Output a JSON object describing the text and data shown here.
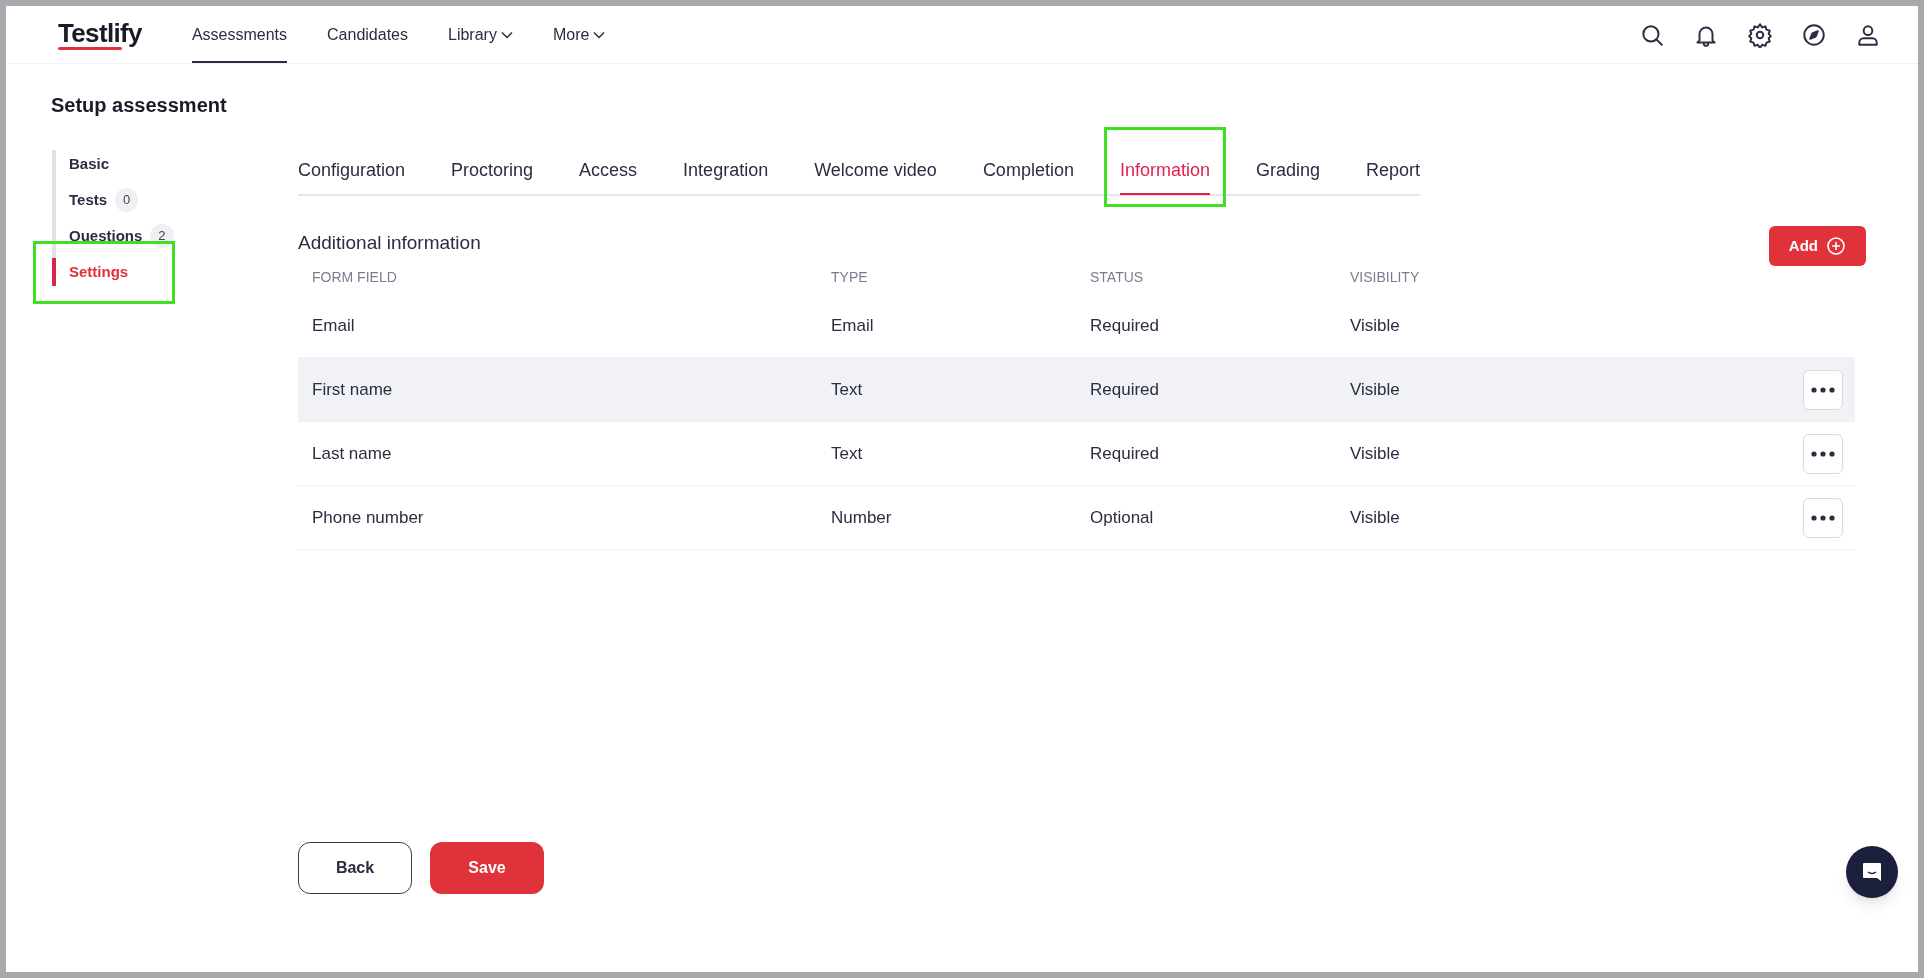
{
  "logo": "Testlify",
  "nav": [
    {
      "label": "Assessments",
      "selected": true,
      "dropdown": false
    },
    {
      "label": "Candidates",
      "selected": false,
      "dropdown": false
    },
    {
      "label": "Library",
      "selected": false,
      "dropdown": true
    },
    {
      "label": "More",
      "selected": false,
      "dropdown": true
    }
  ],
  "page_title": "Setup assessment",
  "sidebar": {
    "items": [
      {
        "label": "Basic",
        "selected": false,
        "highlighted": false
      },
      {
        "label": "Tests",
        "count": "0",
        "selected": false,
        "highlighted": false
      },
      {
        "label": "Questions",
        "count": "2",
        "selected": false,
        "highlighted": false
      },
      {
        "label": "Settings",
        "selected": true,
        "highlighted": true
      }
    ]
  },
  "tabs": [
    {
      "label": "Configuration",
      "selected": false,
      "highlighted": false
    },
    {
      "label": "Proctoring",
      "selected": false,
      "highlighted": false
    },
    {
      "label": "Access",
      "selected": false,
      "highlighted": false
    },
    {
      "label": "Integration",
      "selected": false,
      "highlighted": false
    },
    {
      "label": "Welcome video",
      "selected": false,
      "highlighted": false
    },
    {
      "label": "Completion",
      "selected": false,
      "highlighted": false
    },
    {
      "label": "Information",
      "selected": true,
      "highlighted": true
    },
    {
      "label": "Grading",
      "selected": false,
      "highlighted": false
    },
    {
      "label": "Report",
      "selected": false,
      "highlighted": false
    }
  ],
  "section_title": "Additional information",
  "add_button": "Add",
  "table": {
    "columns": [
      "FORM FIELD",
      "TYPE",
      "STATUS",
      "VISIBILITY"
    ],
    "rows": [
      {
        "cells": [
          "Email",
          "Email",
          "Required",
          "Visible"
        ],
        "hovered": false,
        "has_menu": false
      },
      {
        "cells": [
          "First name",
          "Text",
          "Required",
          "Visible"
        ],
        "hovered": true,
        "has_menu": true
      },
      {
        "cells": [
          "Last name",
          "Text",
          "Required",
          "Visible"
        ],
        "hovered": false,
        "has_menu": true
      },
      {
        "cells": [
          "Phone number",
          "Number",
          "Optional",
          "Visible"
        ],
        "hovered": false,
        "has_menu": true
      }
    ]
  },
  "buttons": {
    "back": "Back",
    "save": "Save"
  }
}
